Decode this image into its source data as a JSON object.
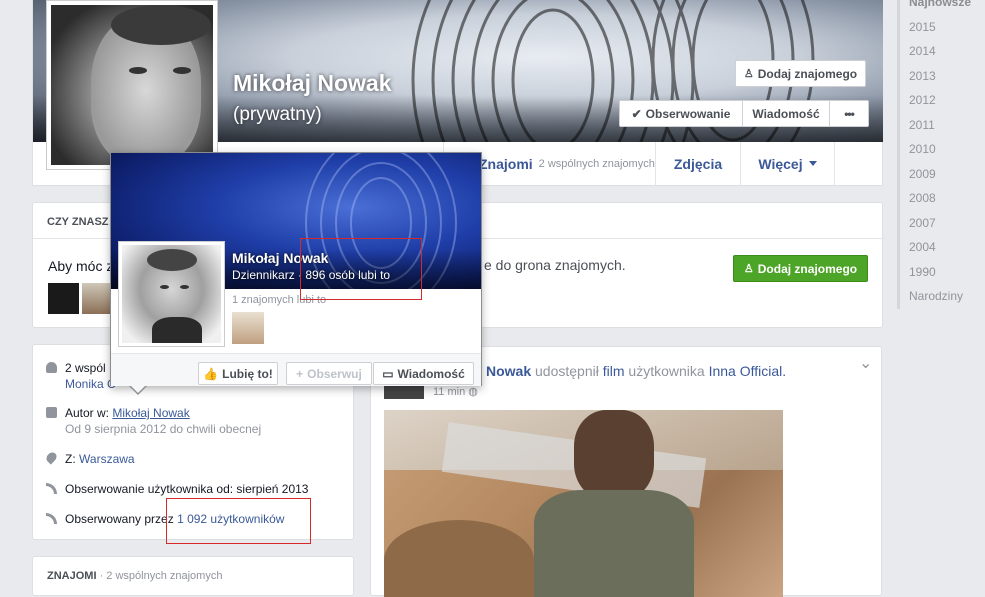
{
  "profile": {
    "name": "Mikołaj Nowak",
    "privacy": "(prywatny)"
  },
  "cover_buttons": {
    "add_friend": "Dodaj znajomego",
    "following": "Obserwowanie",
    "message": "Wiadomość",
    "more": "•••"
  },
  "tabs": {
    "friends": "Znajomi",
    "friends_count": "2 wspólnych znajomych",
    "photos": "Zdjęcia",
    "more": "Więcej"
  },
  "pymk": {
    "header": "CZY ZNASZ",
    "text_start": "Aby móc z",
    "text_end": "e do grona znajomych.",
    "add_button": "Dodaj znajomego"
  },
  "about": {
    "mutual_prefix": "2 wspól",
    "mutual_name": "Monika C",
    "author_label": "Autor w:",
    "author_link": "Mikołaj Nowak",
    "author_dates": "Od 9 sierpnia 2012 do chwili obecnej",
    "from_label": "Z:",
    "from_city": "Warszawa",
    "following_since": "Obserwowanie użytkownika od: sierpień 2013",
    "followed_label": "Obserwowany przez",
    "followed_count": "1 092 użytkowników"
  },
  "friends_box": {
    "header": "ZNAJOMI",
    "count": "· 2 wspólnych znajomych"
  },
  "post": {
    "name": "Nowak",
    "shared": "udostępnił",
    "film": "film",
    "user_label": "użytkownika",
    "page": "Inna Official.",
    "time": "11 min",
    "menu": "⌄"
  },
  "hovercard": {
    "name": "Mikołaj Nowak",
    "role": "Dziennikarz",
    "likes": "· 896 osób lubi to",
    "mutual": "1 znajomych lubi to",
    "like_button": "Lubię to!",
    "follow_button": "Obserwuj",
    "message_button": "Wiadomość"
  },
  "timeline": {
    "years": [
      "Najnowsze",
      "2015",
      "2014",
      "2013",
      "2012",
      "2011",
      "2010",
      "2009",
      "2008",
      "2007",
      "2004",
      "1990",
      "Narodziny"
    ]
  }
}
